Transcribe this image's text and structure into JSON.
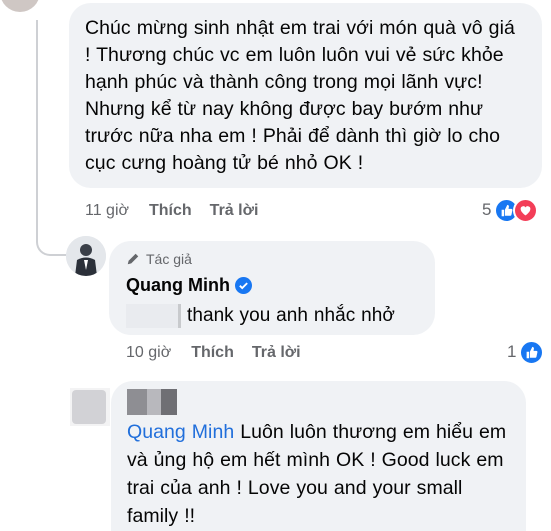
{
  "comment1": {
    "text": "Chúc mừng sinh nhật em trai với món quà vô giá ! Thương chúc vc em luôn luôn vui vẻ sức khỏe hạnh phúc và thành công trong mọi lãnh vực! Nhưng kể từ nay không được bay bướm như trước nữa nha em  ! Phải  để dành thì giờ lo cho cục cưng hoàng tử bé nhỏ OK !",
    "time": "11 giờ",
    "like_action": "Thích",
    "reply_action": "Trả lời",
    "reaction_count": "5",
    "reaction_icons": [
      "like-icon",
      "love-icon"
    ]
  },
  "reply1": {
    "author_badge": "Tác giả",
    "author_name": "Quang Minh",
    "verified_icon": "verified-badge-icon",
    "text": "thank you anh nhắc nhở",
    "time": "10 giờ",
    "like_action": "Thích",
    "reply_action": "Trả lời",
    "reaction_count": "1",
    "reaction_icons": [
      "like-icon"
    ]
  },
  "reply2": {
    "mention": "Quang Minh",
    "text": " Luôn luôn thương em hiểu em và ủng hộ em hết mình OK ! Good luck em trai của anh ! Love you and your small family !!"
  },
  "colors": {
    "bubble": "#f0f2f5",
    "meta_text": "#65676b",
    "like_blue": "#1877f2",
    "love_red": "#f33e58",
    "mention_blue": "#216fdb"
  }
}
